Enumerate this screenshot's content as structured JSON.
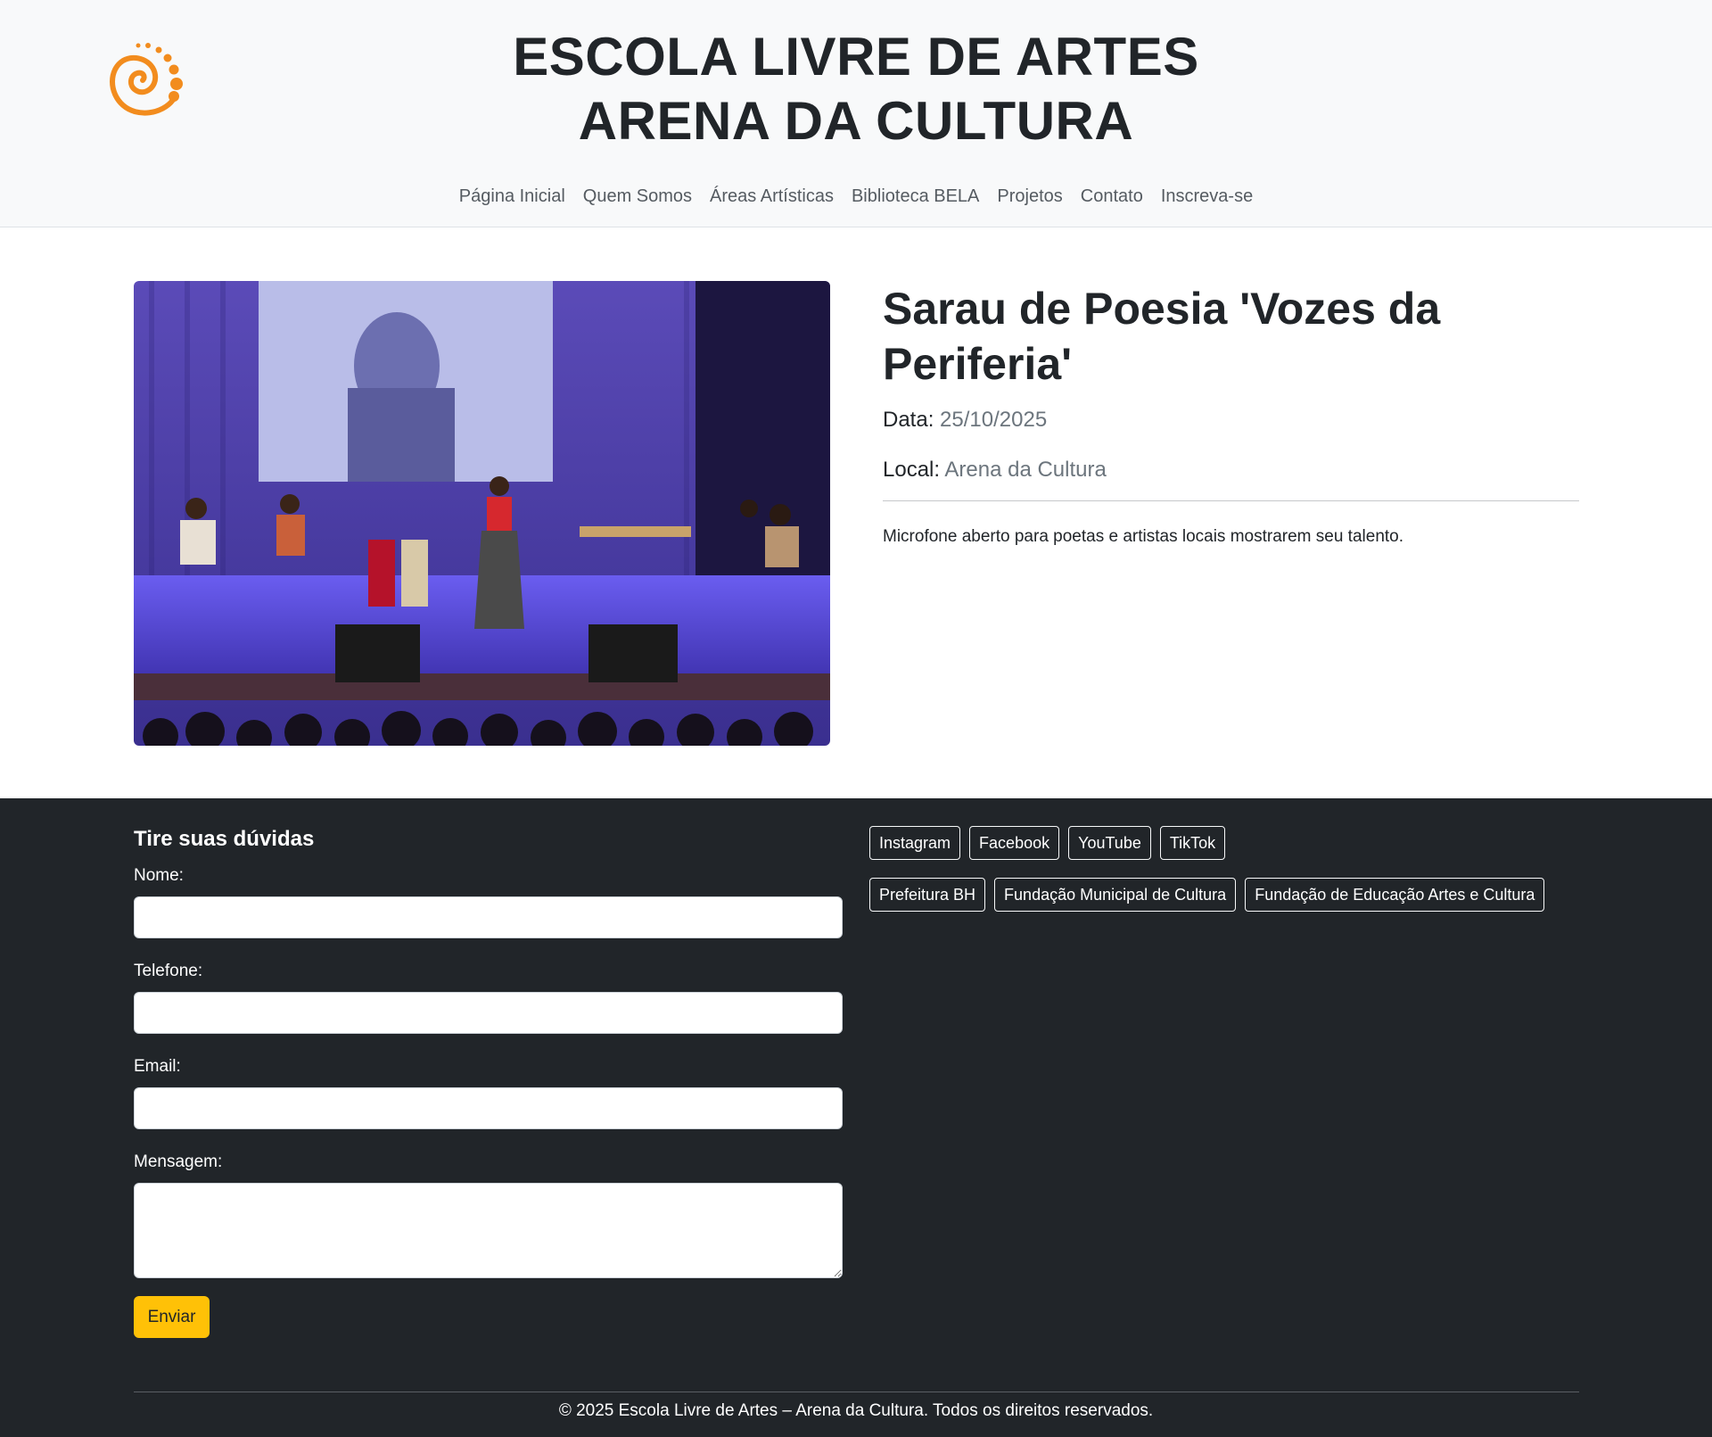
{
  "header": {
    "brand_line1": "ESCOLA LIVRE DE ARTES",
    "brand_line2": "ARENA DA CULTURA",
    "logo_icon": "spiral-logo-icon",
    "logo_color": "#f28c1e",
    "nav": [
      "Página Inicial",
      "Quem Somos",
      "Áreas Artísticas",
      "Biblioteca BELA",
      "Projetos",
      "Contato",
      "Inscreva-se"
    ]
  },
  "event": {
    "title": "Sarau de Poesia 'Vozes da Periferia'",
    "date_label": "Data:",
    "date_value": "25/10/2025",
    "place_label": "Local:",
    "place_value": "Arena da Cultura",
    "description": "Microfone aberto para poetas e artistas locais mostrarem seu talento."
  },
  "footer": {
    "form_title": "Tire suas dúvidas",
    "labels": {
      "name": "Nome:",
      "phone": "Telefone:",
      "email": "Email:",
      "message": "Mensagem:"
    },
    "values": {
      "name": "",
      "phone": "",
      "email": "",
      "message": ""
    },
    "send_label": "Enviar",
    "social_links": [
      "Instagram",
      "Facebook",
      "YouTube",
      "TikTok"
    ],
    "partner_links": [
      "Prefeitura BH",
      "Fundação Municipal de Cultura",
      "Fundação de Educação Artes e Cultura"
    ],
    "copyright": "© 2025 Escola Livre de Artes – Arena da Cultura. Todos os direitos reservados.",
    "accent_color": "#ffc107",
    "background_color": "#212529"
  }
}
